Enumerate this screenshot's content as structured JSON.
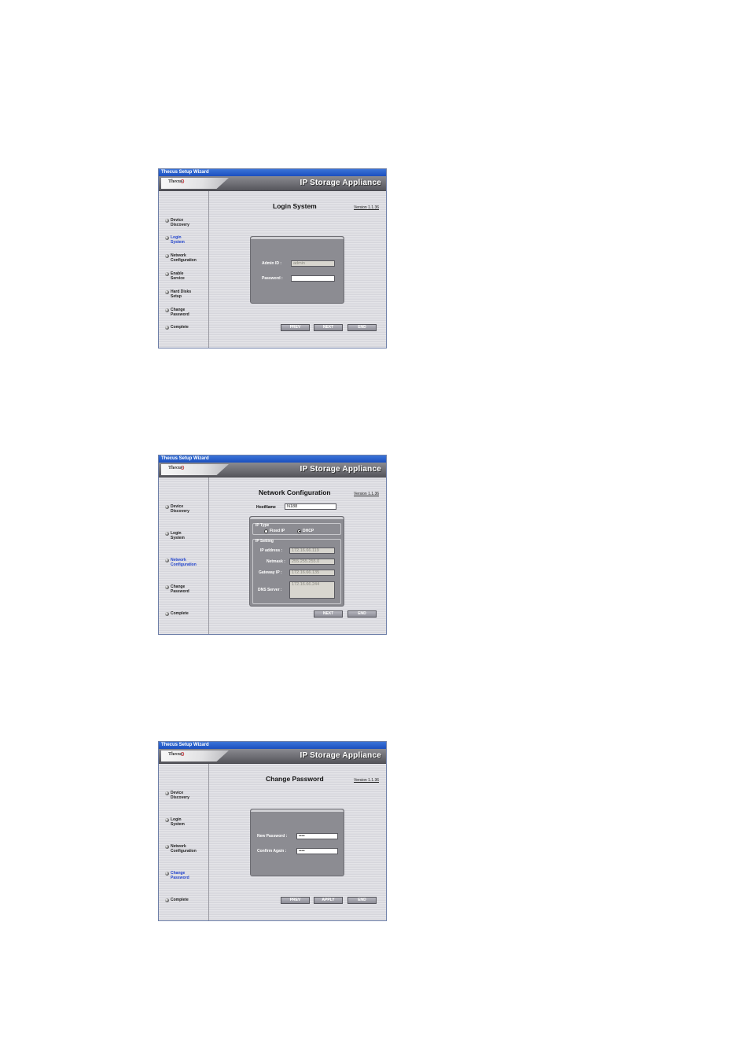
{
  "common": {
    "window_title": "Thecus Setup Wizard",
    "brand_logo": "Thecus",
    "banner_title": "IP Storage Appliance",
    "version": "Version 1.1.36"
  },
  "login": {
    "page_title": "Login System",
    "nav": [
      "Device\nDiscovery",
      "Login\nSystem",
      "Network\nConfiguration",
      "Enable\nService",
      "Hard Disks\nSetup",
      "Change\nPassword",
      "Complete"
    ],
    "admin_id_label": "Admin ID :",
    "admin_id_value": "admin",
    "password_label": "Password :",
    "password_value": "",
    "buttons": {
      "prev": "PREV",
      "next": "NEXT",
      "end": "END"
    }
  },
  "network": {
    "page_title": "Network Configuration",
    "nav": [
      "Device\nDiscovery",
      "Login\nSystem",
      "Network\nConfiguration",
      "Change\nPassword",
      "Complete"
    ],
    "hostname_label": "HostName",
    "hostname_value": "N188",
    "ip_type_title": "IP Type",
    "fixed_ip_label": "Fixed IP",
    "dhcp_label": "DHCP",
    "ip_setting_title": "IP Setting",
    "ip_address_label": "IP address :",
    "ip_address_value": "172.16.66.119",
    "netmask_label": "Netmask :",
    "netmask_value": "255.255.255.0",
    "gateway_label": "Gateway IP :",
    "gateway_value": "172.16.66.135",
    "dns_label": "DNS Server :",
    "dns_value": "172.16.66.244",
    "buttons": {
      "next": "NEXT",
      "end": "END"
    }
  },
  "password": {
    "page_title": "Change Password",
    "nav": [
      "Device\nDiscovery",
      "Login\nSystem",
      "Network\nConfiguration",
      "Change\nPassword",
      "Complete"
    ],
    "new_password_label": "New Password :",
    "new_password_value": "••••",
    "confirm_label": "Confirm Again :",
    "confirm_value": "••••",
    "buttons": {
      "prev": "PREV",
      "apply": "APPLY",
      "end": "END"
    }
  }
}
